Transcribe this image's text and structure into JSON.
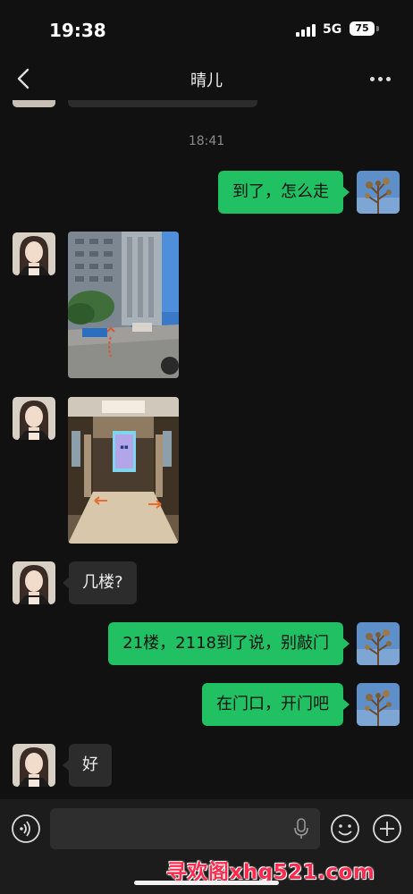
{
  "status_bar": {
    "time": "19:38",
    "network": "5G",
    "battery": "75"
  },
  "nav": {
    "title": "晴儿"
  },
  "chat": {
    "timestamp": "18:41",
    "messages": [
      {
        "type": "text",
        "from": "me",
        "text": "到了，怎么走"
      },
      {
        "type": "image",
        "from": "contact",
        "content": "street-photo"
      },
      {
        "type": "image",
        "from": "contact",
        "content": "elevator-lobby-photo"
      },
      {
        "type": "text",
        "from": "contact",
        "text": "几楼?"
      },
      {
        "type": "text",
        "from": "me",
        "text": "21楼，2118到了说，别敲门"
      },
      {
        "type": "text",
        "from": "me",
        "text": "在门口，开门吧"
      },
      {
        "type": "text",
        "from": "contact",
        "text": "好"
      }
    ]
  },
  "input_bar": {
    "value": ""
  },
  "watermark": "寻欢阁xhg521.com",
  "colors": {
    "outgoing_bubble": "#21c062",
    "incoming_bubble": "#2c2c2c",
    "background": "#111111"
  }
}
